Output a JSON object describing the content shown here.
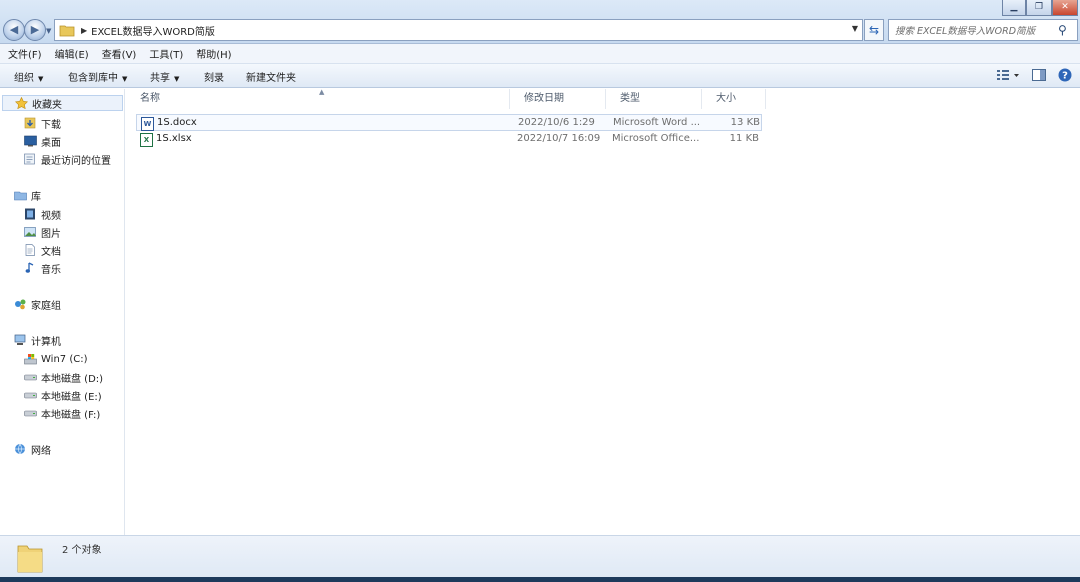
{
  "address": {
    "path": "EXCEL数据导入WORD简版"
  },
  "search": {
    "placeholder": "搜索 EXCEL数据导入WORD简版"
  },
  "menu": [
    "文件(F)",
    "编辑(E)",
    "查看(V)",
    "工具(T)",
    "帮助(H)"
  ],
  "toolbar": {
    "organize": "组织",
    "include": "包含到库中",
    "share": "共享",
    "burn": "刻录",
    "new_folder": "新建文件夹"
  },
  "nav": {
    "favorites": "收藏夹",
    "downloads": "下载",
    "desktop": "桌面",
    "recent": "最近访问的位置",
    "libraries": "库",
    "videos": "视频",
    "pictures": "图片",
    "documents": "文档",
    "music": "音乐",
    "homegroup": "家庭组",
    "computer": "计算机",
    "drive_c": "Win7 (C:)",
    "drive_d": "本地磁盘 (D:)",
    "drive_e": "本地磁盘 (E:)",
    "drive_f": "本地磁盘 (F:)",
    "network": "网络"
  },
  "columns": {
    "name": "名称",
    "date": "修改日期",
    "type": "类型",
    "size": "大小"
  },
  "files": [
    {
      "name": "1S.docx",
      "date": "2022/10/6 1:29",
      "type": "Microsoft Word ...",
      "size": "13 KB",
      "icon": "word-icon"
    },
    {
      "name": "1S.xlsx",
      "date": "2022/10/7 16:09",
      "type": "Microsoft Office...",
      "size": "11 KB",
      "icon": "excel-icon"
    }
  ],
  "status": {
    "count": "2 个对象"
  },
  "colors": {
    "accent": "#2a64b4",
    "bar": "#dfe9f5",
    "selected": "#ebf2fb"
  }
}
